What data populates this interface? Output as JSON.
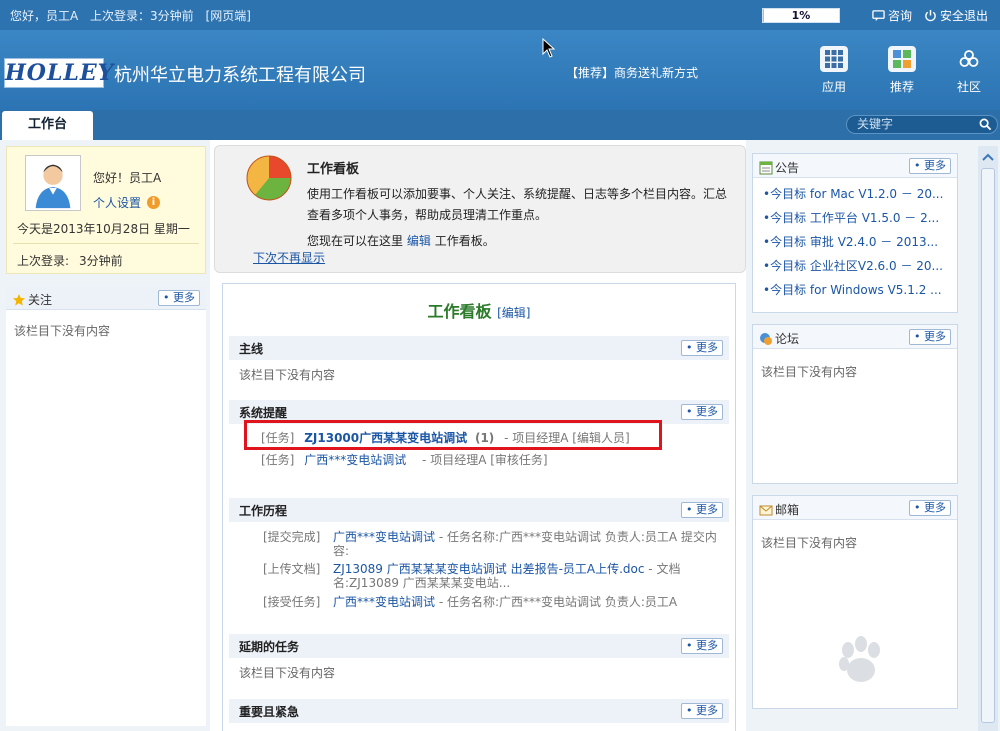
{
  "topbar": {
    "greeting": "您好，员工A",
    "last_login_label": "上次登录：3分钟前",
    "client": "[网页端]",
    "progress_text": "1%",
    "progress_value": 0.01,
    "consult": "咨询",
    "logout": "安全退出"
  },
  "header": {
    "logo_text": "HOLLEY",
    "company": "杭州华立电力系统工程有限公司",
    "promo": "【推荐】商务送礼新方式",
    "buttons": [
      {
        "label": "应用",
        "icon": "apps-grid-icon"
      },
      {
        "label": "推荐",
        "icon": "recommend-icon"
      },
      {
        "label": "社区",
        "icon": "community-icon"
      }
    ]
  },
  "tabs": {
    "active": "工作台",
    "search_placeholder": "关键字"
  },
  "profile": {
    "hello": "您好！员工A",
    "settings": "个人设置",
    "date": "今天是2013年10月28日 星期一",
    "last_login_label": "上次登录:",
    "last_login_value": "3分钟前"
  },
  "follow": {
    "title": "关注",
    "more": "更多",
    "empty": "该栏目下没有内容"
  },
  "intro": {
    "title": "工作看板",
    "desc": "使用工作看板可以添加要事、个人关注、系统提醒、日志等多个栏目内容。汇总查看多项个人事务，帮助成员理清工作重点。",
    "edit_prefix": "您现在可以在这里",
    "edit_link": "编辑",
    "edit_suffix": "工作看板。",
    "no_more": "下次不再显示"
  },
  "board": {
    "title": "工作看板",
    "edit": "[编辑]",
    "more": "更多",
    "empty": "该栏目下没有内容",
    "sections": {
      "main": {
        "title": "主线"
      },
      "reminders": {
        "title": "系统提醒",
        "rows": [
          {
            "tag": "[任务]",
            "link": "ZJ13000广西某某变电站调试",
            "count": "(1)",
            "meta": "- 项目经理A [编辑人员]"
          },
          {
            "tag": "[任务]",
            "link": "广西***变电站调试",
            "count": "",
            "meta": "- 项目经理A [审核任务]"
          }
        ]
      },
      "history": {
        "title": "工作历程",
        "rows": [
          {
            "tag": "[提交完成]",
            "link": "广西***变电站调试",
            "text": " - 任务名称:广西***变电站调试 负责人:员工A 提交内容:"
          },
          {
            "tag": "[上传文档]",
            "link": "ZJ13089 广西某某某变电站调试 出差报告-员工A上传.doc",
            "text": " - 文档名:ZJ13089 广西某某某变电站..."
          },
          {
            "tag": "[接受任务]",
            "link": "广西***变电站调试",
            "text": " - 任务名称:广西***变电站调试 负责人:员工A"
          }
        ]
      },
      "delayed": {
        "title": "延期的任务"
      },
      "urgent": {
        "title": "重要且紧急"
      }
    }
  },
  "notice": {
    "title": "公告",
    "more": "更多",
    "items": [
      "•今目标 for Mac V1.2.0 － 20...",
      "•今目标 工作平台 V1.5.0 － 2...",
      "•今目标 审批 V2.4.0 － 2013...",
      "•今目标 企业社区V2.6.0 － 20...",
      "•今目标 for Windows V5.1.2 ..."
    ]
  },
  "forum": {
    "title": "论坛",
    "more": "更多",
    "empty": "该栏目下没有内容"
  },
  "mailbox": {
    "title": "邮箱",
    "more": "更多",
    "empty": "该栏目下没有内容"
  },
  "colors": {
    "topbar": "#2d73b0",
    "header": "#3b86c4",
    "highlight_box": "#e0141c",
    "board_title": "#2a7a2a",
    "link": "#1b56a5"
  }
}
